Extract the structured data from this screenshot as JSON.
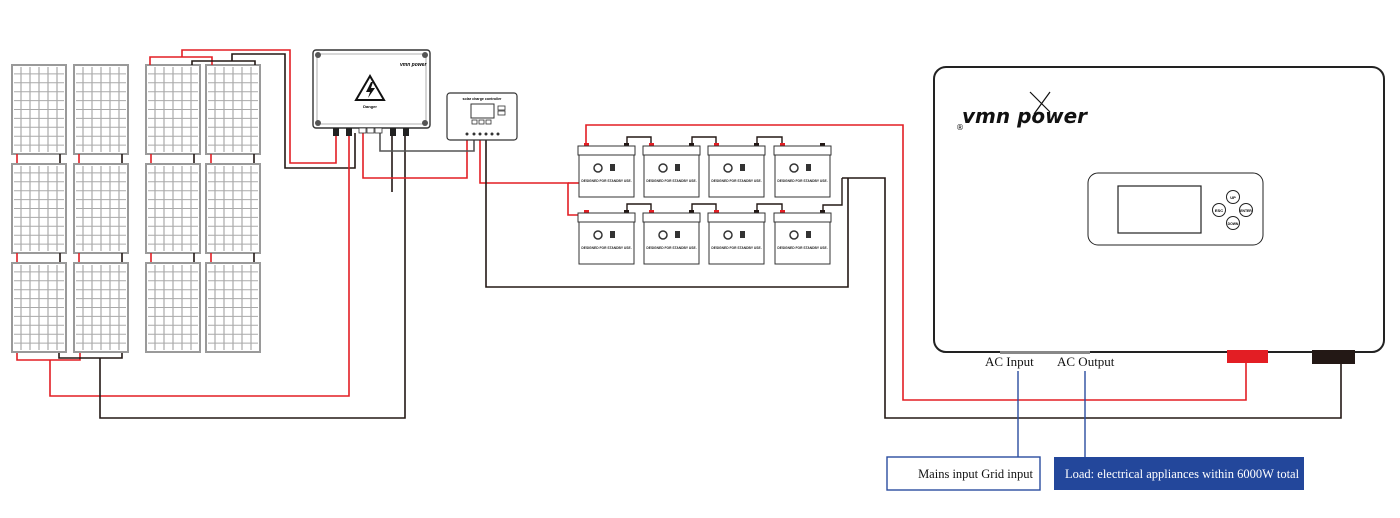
{
  "colors": {
    "positive_wire": "#e31e24",
    "negative_wire": "#231815",
    "annotation_blue": "#2a4da0",
    "load_box_fill": "#23479b",
    "panel_frame": "#9a9a9a"
  },
  "solar_array": {
    "columns": 4,
    "rows": 3,
    "icon": "solar-panel-icon"
  },
  "combiner_box": {
    "logo_text": "vmn power",
    "warning_label": "Danger",
    "icon": "high-voltage-warning-icon"
  },
  "charge_controller": {
    "title": "solar charge controller"
  },
  "battery_bank": {
    "count": 8,
    "label": "DESIGNED FOR STANDBY USE."
  },
  "inverter": {
    "logo_text": "vmn power",
    "buttons": {
      "up": "UP",
      "esc": "ESC",
      "enter": "ENTER",
      "down": "DOWN"
    }
  },
  "labels": {
    "ac_input": "AC Input",
    "ac_output": "AC Output"
  },
  "callouts": {
    "mains": "Mains input  Grid input",
    "load": "Load: electrical appliances within  6000W total"
  }
}
